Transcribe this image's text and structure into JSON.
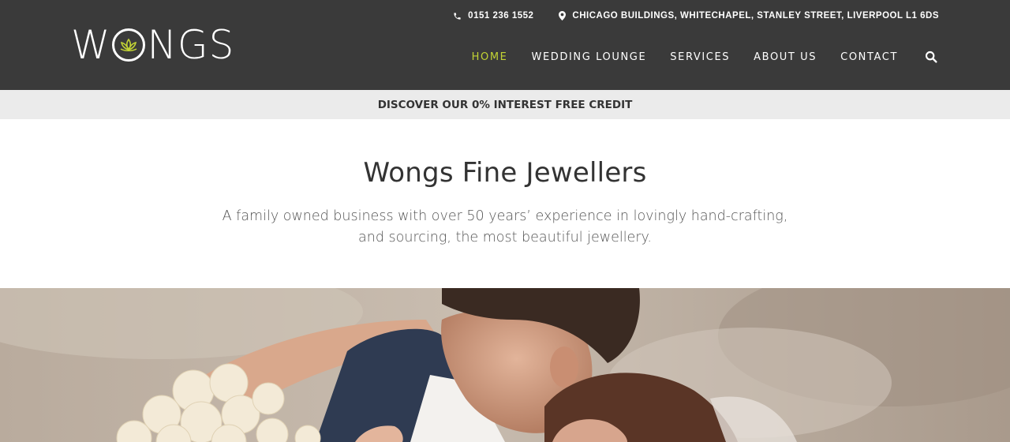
{
  "header": {
    "logo_text": "WONGS",
    "contact": {
      "phone": "0151 236 1552",
      "address": "CHICAGO BUILDINGS, WHITECHAPEL, STANLEY STREET, LIVERPOOL L1 6DS"
    },
    "nav": [
      {
        "label": "HOME",
        "active": true
      },
      {
        "label": "WEDDING LOUNGE",
        "active": false
      },
      {
        "label": "SERVICES",
        "active": false
      },
      {
        "label": "ABOUT US",
        "active": false
      },
      {
        "label": "CONTACT",
        "active": false
      }
    ],
    "icons": [
      "phone-icon",
      "map-pin-icon",
      "search-icon",
      "lotus-icon"
    ]
  },
  "promo": {
    "label": "DISCOVER OUR 0% INTEREST FREE CREDIT"
  },
  "intro": {
    "title": "Wongs Fine Jewellers",
    "text": "A family owned business with over 50 years’ experience in lovingly hand-crafting, and sourcing, the most beautiful jewellery."
  },
  "colors": {
    "header_bg": "#3a3a3a",
    "accent": "#c2d334",
    "promo_bg": "#ebebeb",
    "text_dark": "#333333"
  }
}
